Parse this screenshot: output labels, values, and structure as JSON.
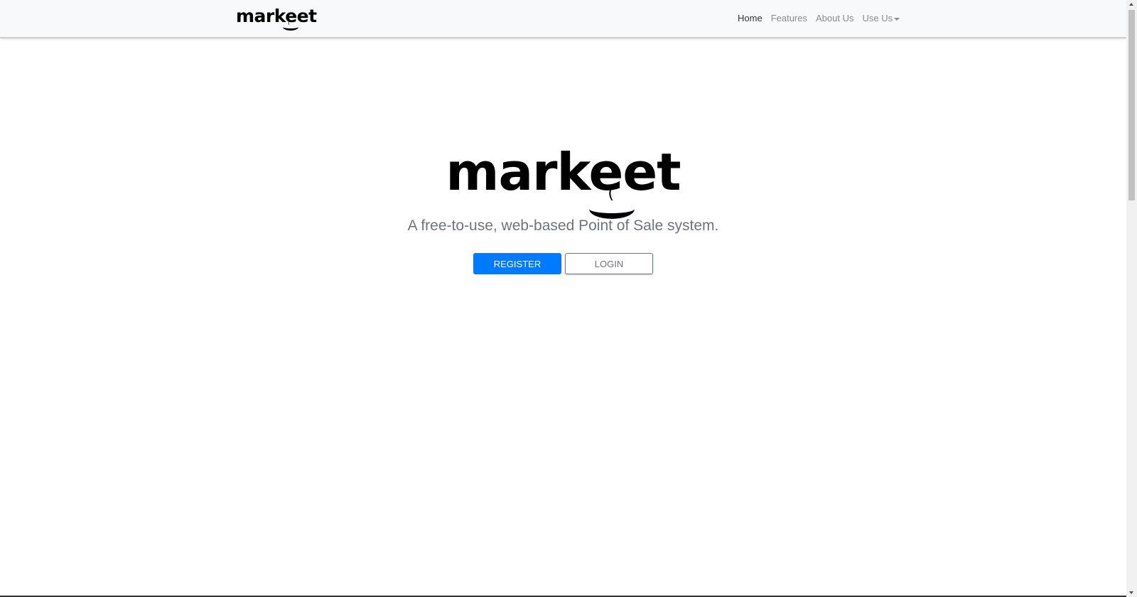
{
  "navbar": {
    "brand": "markeet",
    "links": [
      {
        "label": "Home",
        "active": true
      },
      {
        "label": "Features"
      },
      {
        "label": "About Us"
      },
      {
        "label": "Use Us",
        "dropdown": true
      }
    ]
  },
  "hero": {
    "logo": "markeet",
    "tagline": "A free-to-use, web-based Point of Sale system.",
    "register_label": "REGISTER",
    "login_label": "LOGIN"
  },
  "colors": {
    "primary": "#007bff",
    "navbar_bg": "#f8f9fa",
    "muted": "#6c757d"
  }
}
